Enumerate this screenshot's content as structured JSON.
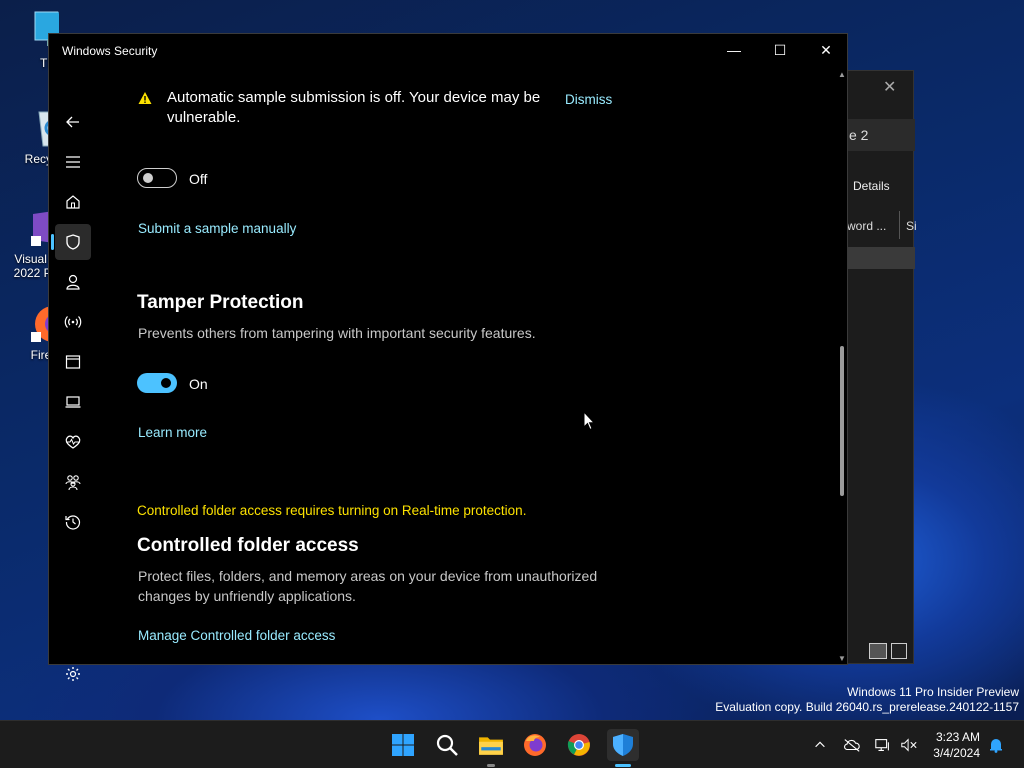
{
  "desktop": {
    "icons": [
      {
        "label": "This P"
      },
      {
        "label": "Recycle"
      },
      {
        "label": "Visual St\n2022 Pre"
      },
      {
        "label": "Firefo"
      }
    ],
    "watermark": {
      "line1": "Windows 11 Pro Insider Preview",
      "line2": "Evaluation copy. Build 26040.rs_prerelease.240122-1157"
    }
  },
  "bg_window": {
    "tab_label": "e 2",
    "details_label": "Details",
    "col1": "word ...",
    "col2": "Si"
  },
  "window": {
    "title": "Windows Security",
    "minimize_glyph": "—",
    "maximize_glyph": "☐",
    "close_glyph": "✕"
  },
  "nav": {
    "items": [
      {
        "name": "back",
        "icon": "back-arrow-icon"
      },
      {
        "name": "menu",
        "icon": "hamburger-menu-icon"
      },
      {
        "name": "home",
        "icon": "home-icon"
      },
      {
        "name": "virus-protection",
        "icon": "shield-icon",
        "active": true
      },
      {
        "name": "account-protection",
        "icon": "person-icon"
      },
      {
        "name": "firewall-network",
        "icon": "wifi-antenna-icon"
      },
      {
        "name": "app-browser-control",
        "icon": "browser-window-icon"
      },
      {
        "name": "device-security",
        "icon": "laptop-icon"
      },
      {
        "name": "device-performance",
        "icon": "heart-pulse-icon"
      },
      {
        "name": "family-options",
        "icon": "family-icon"
      },
      {
        "name": "protection-history",
        "icon": "history-icon"
      },
      {
        "name": "settings",
        "icon": "gear-icon"
      }
    ]
  },
  "content": {
    "warning_text": "Automatic sample submission is off. Your device may be vulnerable.",
    "dismiss_label": "Dismiss",
    "sample_toggle": {
      "state": "off",
      "label": "Off"
    },
    "submit_sample_link": "Submit a sample manually",
    "tamper": {
      "heading": "Tamper Protection",
      "description": "Prevents others from tampering with important security features.",
      "toggle": {
        "state": "on",
        "label": "On"
      },
      "learn_more": "Learn more"
    },
    "cfa": {
      "notice": "Controlled folder access requires turning on Real-time protection.",
      "heading": "Controlled folder access",
      "description": "Protect files, folders, and memory areas on your device from unauthorized changes by unfriendly applications.",
      "manage_link": "Manage Controlled folder access"
    }
  },
  "taskbar": {
    "apps": [
      {
        "name": "start",
        "icon": "windows-logo-icon"
      },
      {
        "name": "search",
        "icon": "search-icon"
      },
      {
        "name": "file-explorer",
        "icon": "folder-icon"
      },
      {
        "name": "firefox",
        "icon": "firefox-icon"
      },
      {
        "name": "chrome",
        "icon": "chrome-icon"
      },
      {
        "name": "windows-security",
        "icon": "defender-shield-icon",
        "active": true
      }
    ],
    "clock": {
      "time": "3:23 AM",
      "date": "3/4/2024"
    }
  },
  "colors": {
    "accent": "#4cc2ff",
    "link": "#99ebff",
    "warning": "#fce100"
  }
}
